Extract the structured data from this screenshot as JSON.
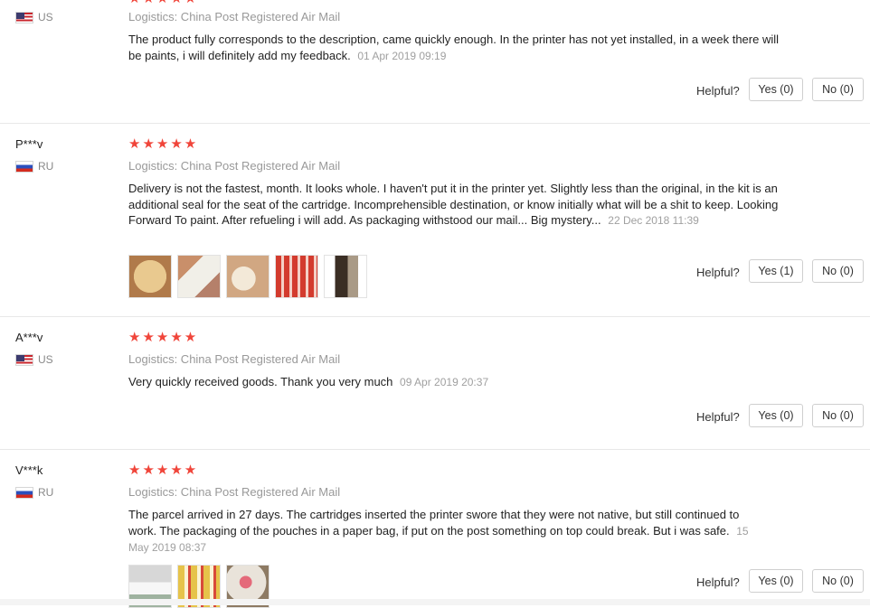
{
  "helpful_label": "Helpful?",
  "reviews": [
    {
      "user": "",
      "country": "US",
      "stars": "★★★★★",
      "logistics": "Logistics: China Post Registered Air Mail",
      "text": "The product fully corresponds to the description, came quickly enough. In the printer has not yet installed, in a week there will be paints, i will definitely add my feedback.",
      "date": "01 Apr 2019 09:19",
      "yes": "Yes (0)",
      "no": "No (0)"
    },
    {
      "user": "P***v",
      "country": "RU",
      "stars": "★★★★★",
      "logistics": "Logistics: China Post Registered Air Mail",
      "text": "Delivery is not the fastest, month. It looks whole. I haven't put it in the printer yet. Slightly less than the original, in the kit is an additional seal for the seat of the cartridge. Incomprehensible destination, or know initially what will be a shit to keep. Looking Forward To paint. After refueling i will add. As packaging withstood our mail... Big mystery...",
      "date": "22 Dec 2018 11:39",
      "yes": "Yes (1)",
      "no": "No (0)"
    },
    {
      "user": "A***v",
      "country": "US",
      "stars": "★★★★★",
      "logistics": "Logistics: China Post Registered Air Mail",
      "text": "Very quickly received goods. Thank you very much",
      "date": "09 Apr 2019 20:37",
      "yes": "Yes (0)",
      "no": "No (0)"
    },
    {
      "user": "V***k",
      "country": "RU",
      "stars": "★★★★★",
      "logistics": "Logistics: China Post Registered Air Mail",
      "text": "The parcel arrived in 27 days. The cartridges inserted the printer swore that they were not native, but still continued to work. The packaging of the pouches in a paper bag, if put on the post something on top could break. But i was safe.",
      "date": "15 May 2019 08:37",
      "yes": "Yes (0)",
      "no": "No (0)"
    }
  ]
}
